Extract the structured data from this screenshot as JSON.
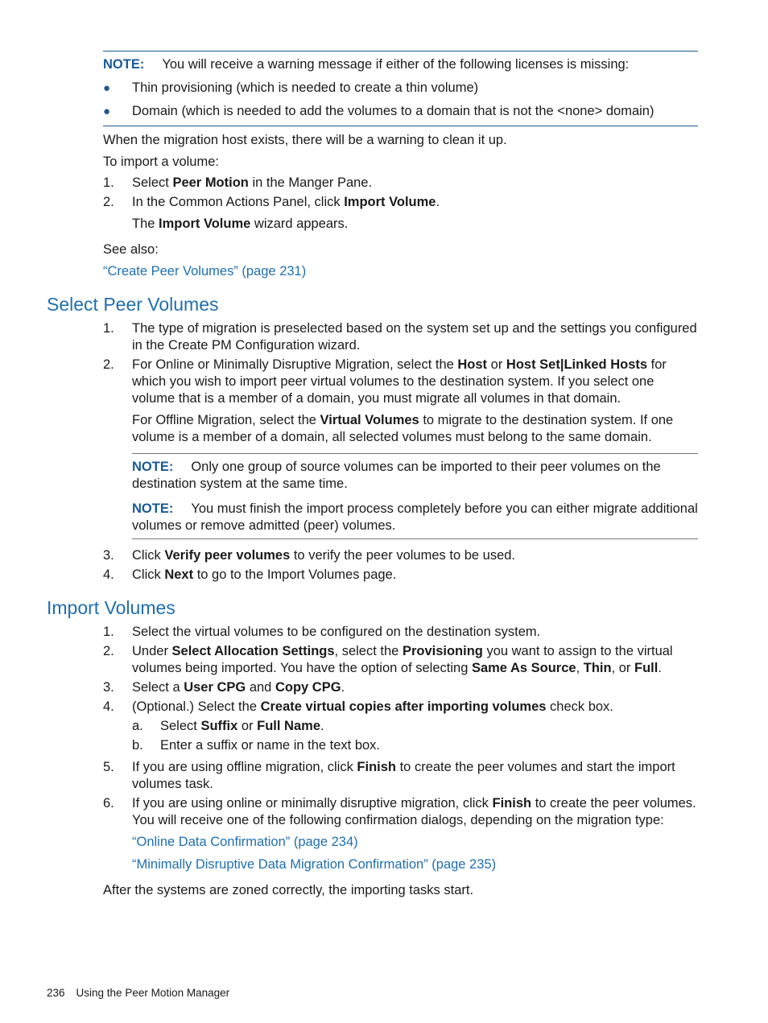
{
  "colors": {
    "accent": "#1a5a96",
    "heading": "#1f6fb0"
  },
  "note1": {
    "label": "NOTE:",
    "text": "You will receive a warning message if either of the following licenses is missing:",
    "bullets": [
      "Thin provisioning (which is needed to create a thin volume)",
      "Domain (which is needed to add the volumes to a domain that is not the <none> domain)"
    ]
  },
  "intro": {
    "p1": "When the migration host exists, there will be a warning to clean it up.",
    "p2": "To import a volume:",
    "steps": [
      {
        "n": "1.",
        "rich": [
          {
            "t": "Select "
          },
          {
            "t": "Peer Motion",
            "b": true
          },
          {
            "t": " in the Manger Pane."
          }
        ]
      },
      {
        "n": "2.",
        "rich": [
          {
            "t": "In the Common Actions Panel, click "
          },
          {
            "t": "Import Volume",
            "b": true
          },
          {
            "t": "."
          }
        ]
      }
    ],
    "step2_result": [
      {
        "t": "The "
      },
      {
        "t": "Import Volume",
        "b": true
      },
      {
        "t": " wizard appears."
      }
    ],
    "see_also": "See also:",
    "link": "“Create Peer Volumes” (page 231)"
  },
  "select_peer": {
    "heading": "Select Peer Volumes",
    "steps": [
      {
        "n": "1.",
        "rich": [
          {
            "t": "The type of migration is preselected based on the system set up and the settings you configured in the Create PM Configuration wizard."
          }
        ]
      },
      {
        "n": "2.",
        "rich": [
          {
            "t": "For Online or Minimally Disruptive Migration, select the "
          },
          {
            "t": "Host",
            "b": true
          },
          {
            "t": " or "
          },
          {
            "t": "Host Set|Linked Hosts",
            "b": true
          },
          {
            "t": " for which you wish to import peer virtual volumes to the destination system. If you select one volume that is a member of a domain, you must migrate all volumes in that domain."
          }
        ]
      },
      {
        "n": "3.",
        "rich": [
          {
            "t": "Click "
          },
          {
            "t": "Verify peer volumes",
            "b": true
          },
          {
            "t": " to verify the peer volumes to be used."
          }
        ]
      },
      {
        "n": "4.",
        "rich": [
          {
            "t": "Click "
          },
          {
            "t": "Next",
            "b": true
          },
          {
            "t": " to go to the Import Volumes page."
          }
        ]
      }
    ],
    "step2_extra": [
      {
        "t": "For Offline Migration, select the "
      },
      {
        "t": "Virtual Volumes",
        "b": true
      },
      {
        "t": " to migrate to the destination system. If one volume is a member of a domain, all selected volumes must belong to the same domain."
      }
    ],
    "notes": [
      {
        "label": "NOTE:",
        "text": "Only one group of source volumes can be imported to their peer volumes on the destination system at the same time."
      },
      {
        "label": "NOTE:",
        "text": "You must finish the import process completely before you can either migrate additional volumes or remove admitted (peer) volumes."
      }
    ]
  },
  "import_volumes": {
    "heading": "Import Volumes",
    "steps": [
      {
        "n": "1.",
        "rich": [
          {
            "t": "Select the virtual volumes to be configured on the destination system."
          }
        ]
      },
      {
        "n": "2.",
        "rich": [
          {
            "t": "Under "
          },
          {
            "t": "Select Allocation Settings",
            "b": true
          },
          {
            "t": ", select the "
          },
          {
            "t": "Provisioning",
            "b": true
          },
          {
            "t": " you want to assign to the virtual volumes being imported. You have the option of selecting "
          },
          {
            "t": "Same As Source",
            "b": true
          },
          {
            "t": ", "
          },
          {
            "t": "Thin",
            "b": true
          },
          {
            "t": ", or "
          },
          {
            "t": "Full",
            "b": true
          },
          {
            "t": "."
          }
        ]
      },
      {
        "n": "3.",
        "rich": [
          {
            "t": "Select a "
          },
          {
            "t": "User CPG",
            "b": true
          },
          {
            "t": " and "
          },
          {
            "t": "Copy CPG",
            "b": true
          },
          {
            "t": "."
          }
        ]
      },
      {
        "n": "4.",
        "rich": [
          {
            "t": "(Optional.) Select the "
          },
          {
            "t": "Create virtual copies after importing volumes",
            "b": true
          },
          {
            "t": " check box."
          }
        ]
      },
      {
        "n": "5.",
        "rich": [
          {
            "t": "If you are using offline migration, click "
          },
          {
            "t": "Finish",
            "b": true
          },
          {
            "t": " to create the peer volumes and start the import volumes task."
          }
        ]
      },
      {
        "n": "6.",
        "rich": [
          {
            "t": "If you are using online or minimally disruptive migration, click "
          },
          {
            "t": "Finish",
            "b": true
          },
          {
            "t": " to create the peer volumes. You will receive one of the following confirmation dialogs, depending on the migration type:"
          }
        ]
      }
    ],
    "substeps": [
      {
        "n": "a.",
        "rich": [
          {
            "t": "Select "
          },
          {
            "t": "Suffix",
            "b": true
          },
          {
            "t": " or "
          },
          {
            "t": "Full Name",
            "b": true
          },
          {
            "t": "."
          }
        ]
      },
      {
        "n": "b.",
        "rich": [
          {
            "t": "Enter a suffix or name in the text box."
          }
        ]
      }
    ],
    "links": [
      "“Online Data Confirmation” (page 234)",
      "“Minimally Disruptive Data Migration Confirmation” (page 235)"
    ],
    "after": "After the systems are zoned correctly, the importing tasks start."
  },
  "footer": {
    "page": "236",
    "title": "Using the Peer Motion Manager"
  }
}
